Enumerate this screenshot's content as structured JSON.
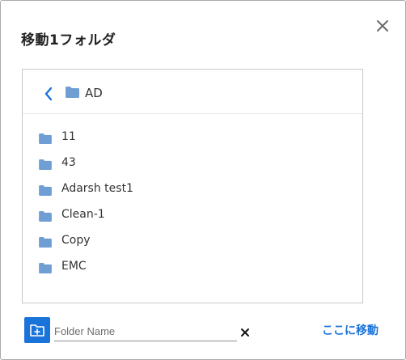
{
  "dialog": {
    "title": "移動1フォルダ",
    "close_icon": "close-icon"
  },
  "browser": {
    "back_icon": "chevron-left-icon",
    "current_folder": "AD",
    "folder_icon": "folder-icon",
    "folders": [
      {
        "label": "11"
      },
      {
        "label": "43"
      },
      {
        "label": "Adarsh test1"
      },
      {
        "label": "Clean-1"
      },
      {
        "label": "Copy"
      },
      {
        "label": "EMC"
      }
    ]
  },
  "footer": {
    "new_folder_icon": "new-folder-icon",
    "folder_name_placeholder": "Folder Name",
    "folder_name_value": "",
    "clear_icon": "clear-icon",
    "move_here_label": "ここに移動"
  },
  "colors": {
    "accent": "#1a73d9",
    "folder": "#6f9ed4",
    "border": "#c8c8c8",
    "text": "#333333"
  }
}
